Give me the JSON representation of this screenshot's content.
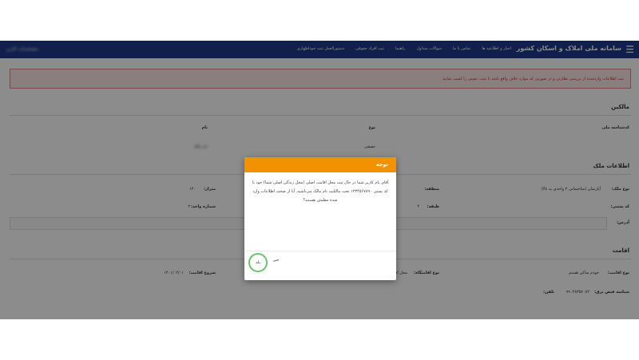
{
  "navbar": {
    "brand": "سامانه ملی املاک و اسکان کشور",
    "links": [
      "اخبار و اطلاعیه ها",
      "تماس با ما",
      "سوالات متداول",
      "راهنما",
      "ثبت افراد حقوقی",
      "دستورالعمل ثبت خوداظهاری"
    ],
    "user": "مشخصات کاربر"
  },
  "alert": "ثبت اطلاعات واردشده از بررسی نظارتی و در صورتی که موارد خلاف واقع باشد با ثبت، تبعیتی را کسب نمایید",
  "owners": {
    "title": "مالکین",
    "col_national_id": "کدشناسه ملی",
    "col_type": "نوع",
    "col_name": "نام",
    "type_value": "حقیقی",
    "name_value": "نام مالک"
  },
  "property": {
    "title": "اطلاعات ملک",
    "type_label": "نوع ملک:",
    "type_value": "آپارتمان (ساختمانی ۲ واحدی به بالا)",
    "region_label": "منطقه:",
    "area_label": "متراژ:",
    "area_value": "۱۴۰",
    "postal_label": "کد پستی:",
    "floor_label": "طبقه:",
    "floor_value": "۲",
    "unit_label": "شماره واحد:",
    "unit_value": "۲",
    "address_label": "آدرس:"
  },
  "residence": {
    "title": "اقامت",
    "type_label": "نوع اقامت:",
    "type_value": "خودم ساکن هستم",
    "place_label": "نوع اقامتگاه:",
    "place_value": "محل اقامت اصلی (محل زندگی اصلی شما)",
    "start_label": "شروع اقامت:",
    "start_value": "۱۴۰۱/۰۲/۰۱",
    "id_label": "شناسه قبض برق:",
    "id_value": "۹۹۰۴۸۳۵۷۰۸۲",
    "phone_label": "تلفن:"
  },
  "modal": {
    "title": "توجه",
    "body": "آقای نام کاربر شما در حال ثبت محل اقامت اصلی (محل زندگی اصلی شما) خود با کد پستی ۱۲۳۴۵۶۷۸۹۰ تحت مالکیت نام مالک می‌باشید. آیا از صحت اطلاعات وارد شده مطمئن هستید؟",
    "yes": "بله",
    "no": "خیر"
  }
}
